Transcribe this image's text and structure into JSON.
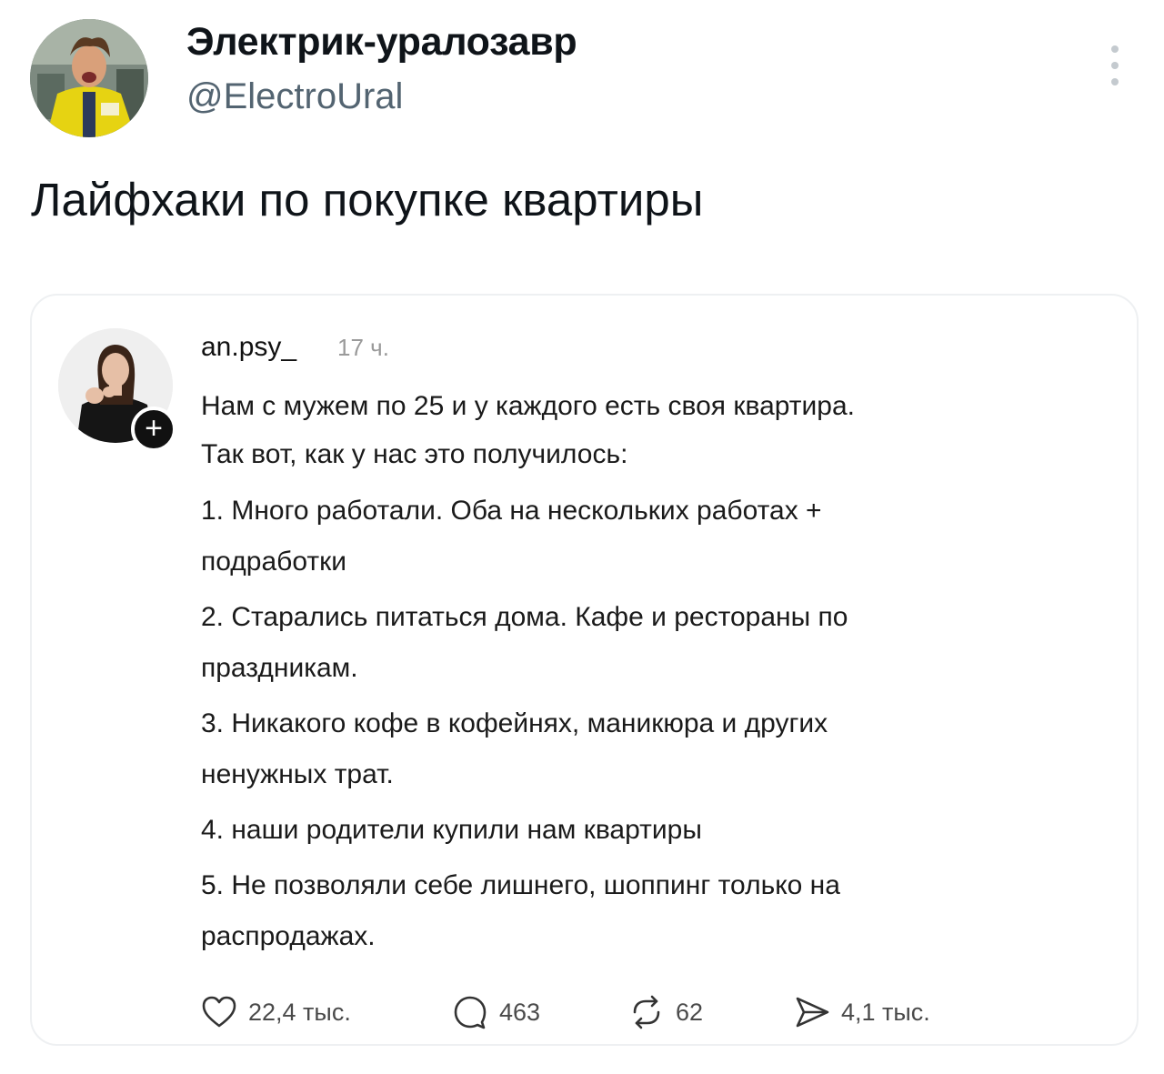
{
  "tweet": {
    "author_name": "Электрик-уралозавр",
    "author_handle": "@ElectroUral",
    "text": "Лайфхаки по покупке квартиры"
  },
  "quoted_post": {
    "username": "an.psy_",
    "time": "17 ч.",
    "lines": [
      "Нам с мужем по 25 и у каждого есть своя квартира.",
      "Так вот, как у нас это получилось:",
      "1. Много работали. Оба на нескольких работах +",
      "подработки",
      "2. Старались питаться дома. Кафе и рестораны по",
      "праздникам.",
      "3. Никакого кофе в кофейнях, маникюра и других",
      "ненужных трат.",
      "4. наши родители купили нам квартиры",
      "5. Не позволяли себе лишнего, шоппинг только на",
      "распродажах."
    ],
    "actions": {
      "likes": "22,4 тыс.",
      "replies": "463",
      "reposts": "62",
      "shares": "4,1 тыс."
    },
    "follow_glyph": "+"
  }
}
